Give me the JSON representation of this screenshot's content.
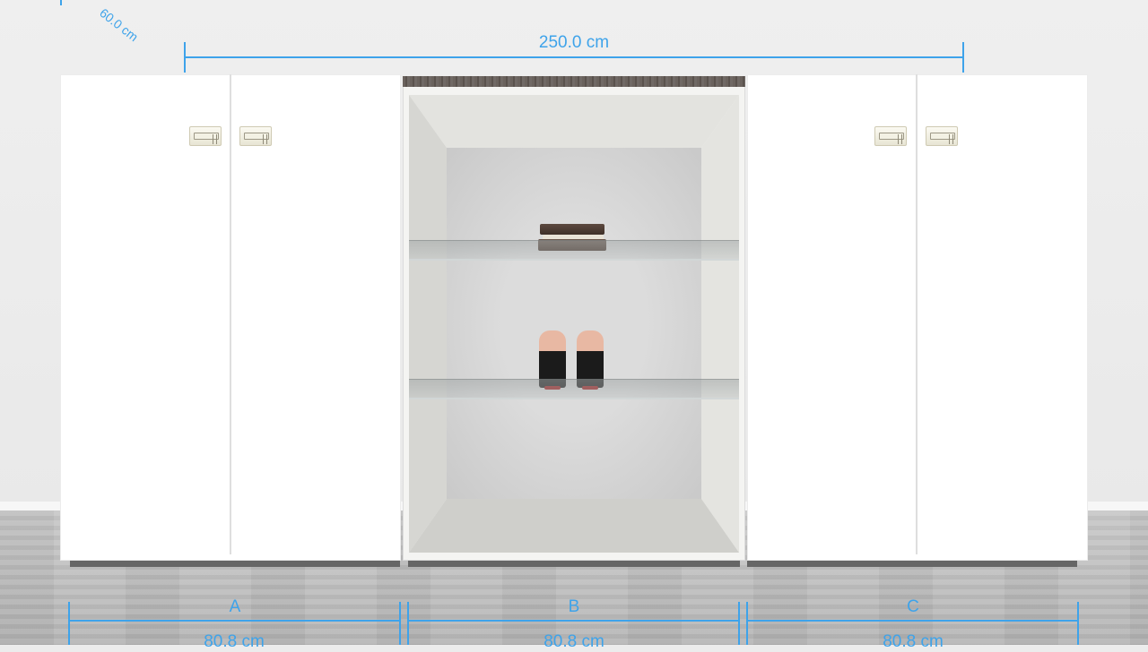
{
  "scene": {
    "overall_width": "250.0 cm",
    "depth": "60.0 cm",
    "sections": [
      {
        "label": "A",
        "width": "80.8 cm"
      },
      {
        "label": "B",
        "width": "80.8 cm"
      },
      {
        "label": "C",
        "width": "80.8 cm"
      }
    ]
  },
  "colors": {
    "dimension": "#3ea3ea",
    "cabinet": "#ffffff",
    "plinth": "#666666"
  }
}
